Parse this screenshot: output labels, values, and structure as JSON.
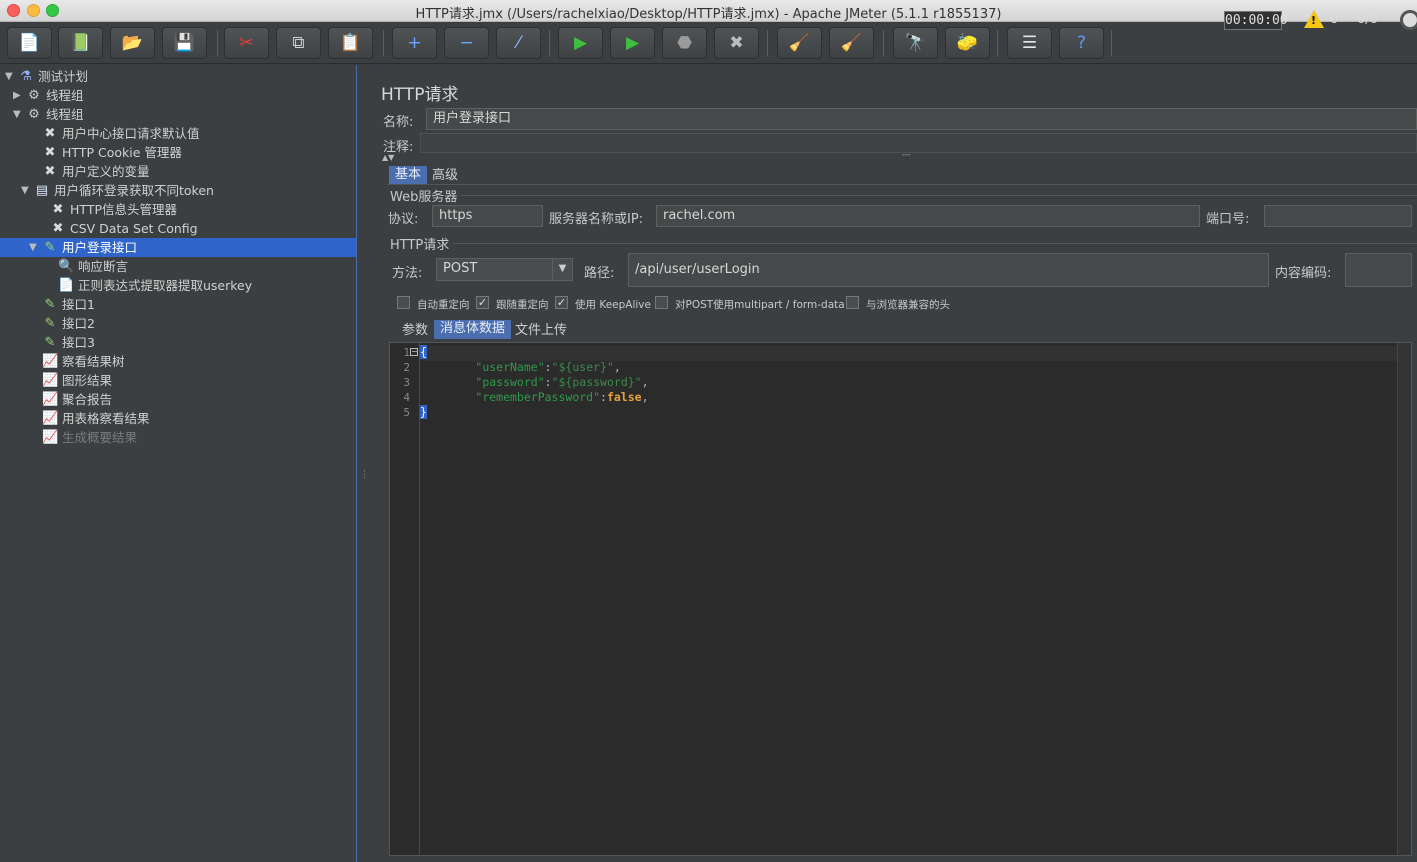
{
  "window": {
    "title": "HTTP请求.jmx (/Users/rachelxiao/Desktop/HTTP请求.jmx) - Apache JMeter (5.1.1 r1855137)"
  },
  "toolbar": {
    "timer": "00:00:00",
    "warning_count": "0",
    "thread_count": "0/0",
    "buttons": [
      {
        "name": "new-icon",
        "glyph": "📄"
      },
      {
        "name": "templates-icon",
        "glyph": "📗"
      },
      {
        "name": "open-icon",
        "glyph": "📂"
      },
      {
        "name": "save-icon",
        "glyph": "💾"
      },
      {
        "name": "cut-icon",
        "glyph": "✂"
      },
      {
        "name": "copy-icon",
        "glyph": "⧉"
      },
      {
        "name": "paste-icon",
        "glyph": "📋"
      },
      {
        "name": "expand-icon",
        "glyph": "+"
      },
      {
        "name": "collapse-icon",
        "glyph": "−"
      },
      {
        "name": "toggle-icon",
        "glyph": "⁄"
      },
      {
        "name": "start-icon",
        "glyph": "▶"
      },
      {
        "name": "start-no-pause-icon",
        "glyph": "▶"
      },
      {
        "name": "stop-icon",
        "glyph": "⬣"
      },
      {
        "name": "shutdown-icon",
        "glyph": "✖"
      },
      {
        "name": "clear-icon",
        "glyph": "🧹"
      },
      {
        "name": "clear-all-icon",
        "glyph": "🧹"
      },
      {
        "name": "search-icon",
        "glyph": "🔭"
      },
      {
        "name": "reset-search-icon",
        "glyph": "🧽"
      },
      {
        "name": "function-helper-icon",
        "glyph": "☰"
      },
      {
        "name": "help-icon",
        "glyph": "?"
      }
    ]
  },
  "tree": {
    "nodes": [
      {
        "label": "测试计划",
        "icon": "flask-icon",
        "glyph": "⚗",
        "arrow": "▼",
        "state": "normal"
      },
      {
        "label": "线程组",
        "icon": "gear-icon",
        "glyph": "⚙",
        "arrow": "▶",
        "state": "normal"
      },
      {
        "label": "线程组",
        "icon": "gear-icon",
        "glyph": "⚙",
        "arrow": "▼",
        "state": "normal"
      },
      {
        "label": "用户中心接口请求默认值",
        "icon": "wrench-icon",
        "glyph": "✖",
        "arrow": "",
        "state": "normal"
      },
      {
        "label": "HTTP Cookie 管理器",
        "icon": "wrench-icon",
        "glyph": "✖",
        "arrow": "",
        "state": "normal"
      },
      {
        "label": "用户定义的变量",
        "icon": "wrench-icon",
        "glyph": "✖",
        "arrow": "",
        "state": "normal"
      },
      {
        "label": "用户循环登录获取不同token",
        "icon": "controller-icon",
        "glyph": "▤",
        "arrow": "▼",
        "state": "normal"
      },
      {
        "label": "HTTP信息头管理器",
        "icon": "wrench-icon",
        "glyph": "✖",
        "arrow": "",
        "state": "normal"
      },
      {
        "label": "CSV Data Set Config",
        "icon": "wrench-icon",
        "glyph": "✖",
        "arrow": "",
        "state": "normal"
      },
      {
        "label": "用户登录接口",
        "icon": "pipette-icon",
        "glyph": "✎",
        "arrow": "▼",
        "state": "selected"
      },
      {
        "label": "响应断言",
        "icon": "assertion-icon",
        "glyph": "🔍",
        "arrow": "",
        "state": "normal"
      },
      {
        "label": "正则表达式提取器提取userkey",
        "icon": "extractor-icon",
        "glyph": "📄",
        "arrow": "",
        "state": "normal"
      },
      {
        "label": "接口1",
        "icon": "pipette-icon",
        "glyph": "✎",
        "arrow": "",
        "state": "normal"
      },
      {
        "label": "接口2",
        "icon": "pipette-icon",
        "glyph": "✎",
        "arrow": "",
        "state": "normal"
      },
      {
        "label": "接口3",
        "icon": "pipette-icon",
        "glyph": "✎",
        "arrow": "",
        "state": "normal"
      },
      {
        "label": "察看结果树",
        "icon": "listener-icon",
        "glyph": "📈",
        "arrow": "",
        "state": "normal"
      },
      {
        "label": "图形结果",
        "icon": "listener-icon",
        "glyph": "📈",
        "arrow": "",
        "state": "normal"
      },
      {
        "label": "聚合报告",
        "icon": "listener-icon",
        "glyph": "📈",
        "arrow": "",
        "state": "normal"
      },
      {
        "label": "用表格察看结果",
        "icon": "listener-icon",
        "glyph": "📈",
        "arrow": "",
        "state": "normal"
      },
      {
        "label": "生成概要结果",
        "icon": "listener-icon",
        "glyph": "📈",
        "arrow": "",
        "state": "disabled"
      }
    ]
  },
  "sampler": {
    "title": "HTTP请求",
    "name_label": "名称:",
    "name_value": "用户登录接口",
    "comment_label": "注释:",
    "comment_value": "",
    "tabs": [
      "基本",
      "高级"
    ],
    "web_server": {
      "group_title": "Web服务器",
      "protocol_label": "协议:",
      "protocol_value": "https",
      "server_label": "服务器名称或IP:",
      "server_value": "rachel.com",
      "port_label": "端口号:",
      "port_value": ""
    },
    "http_request": {
      "group_title": "HTTP请求",
      "method_label": "方法:",
      "method_value": "POST",
      "path_label": "路径:",
      "path_value": "/api/user/userLogin",
      "encoding_label": "内容编码:",
      "encoding_value": ""
    },
    "options": [
      {
        "label": "自动重定向",
        "checked": false
      },
      {
        "label": "跟随重定向",
        "checked": true
      },
      {
        "label": "使用 KeepAlive",
        "checked": true
      },
      {
        "label": "对POST使用multipart / form-data",
        "checked": false
      },
      {
        "label": "与浏览器兼容的头",
        "checked": false
      }
    ],
    "body_tabs": [
      "参数",
      "消息体数据",
      "文件上传"
    ],
    "body_lines": [
      {
        "num": "1",
        "text": "{"
      },
      {
        "num": "2",
        "key": "\"userName\"",
        "sep": ":",
        "val": "\"${user}\"",
        "end": ","
      },
      {
        "num": "3",
        "key": "\"password\"",
        "sep": ":",
        "val": "\"${password}\"",
        "end": ","
      },
      {
        "num": "4",
        "key": "\"rememberPassword\"",
        "sep": ":",
        "val": "false",
        "end": ","
      },
      {
        "num": "5",
        "text": "}"
      }
    ]
  }
}
